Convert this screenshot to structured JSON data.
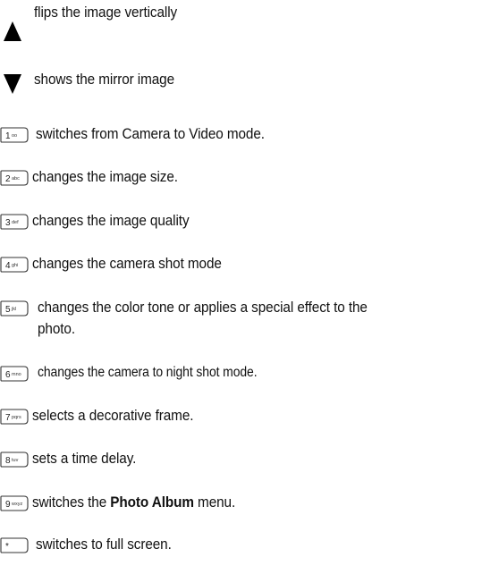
{
  "items": [
    {
      "icon": "up-arrow-icon",
      "text": "flips the image vertically"
    },
    {
      "icon": "down-arrow-icon",
      "text": "shows the mirror image"
    },
    {
      "icon": "key-1-icon",
      "key_label": "1",
      "key_sub": "oo",
      "text": "switches from Camera to Video mode."
    },
    {
      "icon": "key-2-icon",
      "key_label": "2",
      "key_sub": "abc",
      "text": "changes the image size."
    },
    {
      "icon": "key-3-icon",
      "key_label": "3",
      "key_sub": "def",
      "text": "changes the image quality"
    },
    {
      "icon": "key-4-icon",
      "key_label": "4",
      "key_sub": "ghi",
      "text": "changes the camera shot mode"
    },
    {
      "icon": "key-5-icon",
      "key_label": "5",
      "key_sub": "jkl",
      "text": "changes the color tone or applies a special effect to the photo."
    },
    {
      "icon": "key-6-icon",
      "key_label": "6",
      "key_sub": "mno",
      "text": "changes the camera to night shot mode."
    },
    {
      "icon": "key-7-icon",
      "key_label": "7",
      "key_sub": "pqrs",
      "text": "selects a decorative frame."
    },
    {
      "icon": "key-8-icon",
      "key_label": "8",
      "key_sub": "tuv",
      "text": "sets a time delay."
    },
    {
      "icon": "key-9-icon",
      "key_label": "9",
      "key_sub": "wxyz",
      "text_before": "switches the ",
      "text_bold": "Photo Album",
      "text_after": " menu."
    },
    {
      "icon": "key-star-icon",
      "key_label": "*",
      "key_sub": "",
      "text": "switches to full screen."
    }
  ]
}
